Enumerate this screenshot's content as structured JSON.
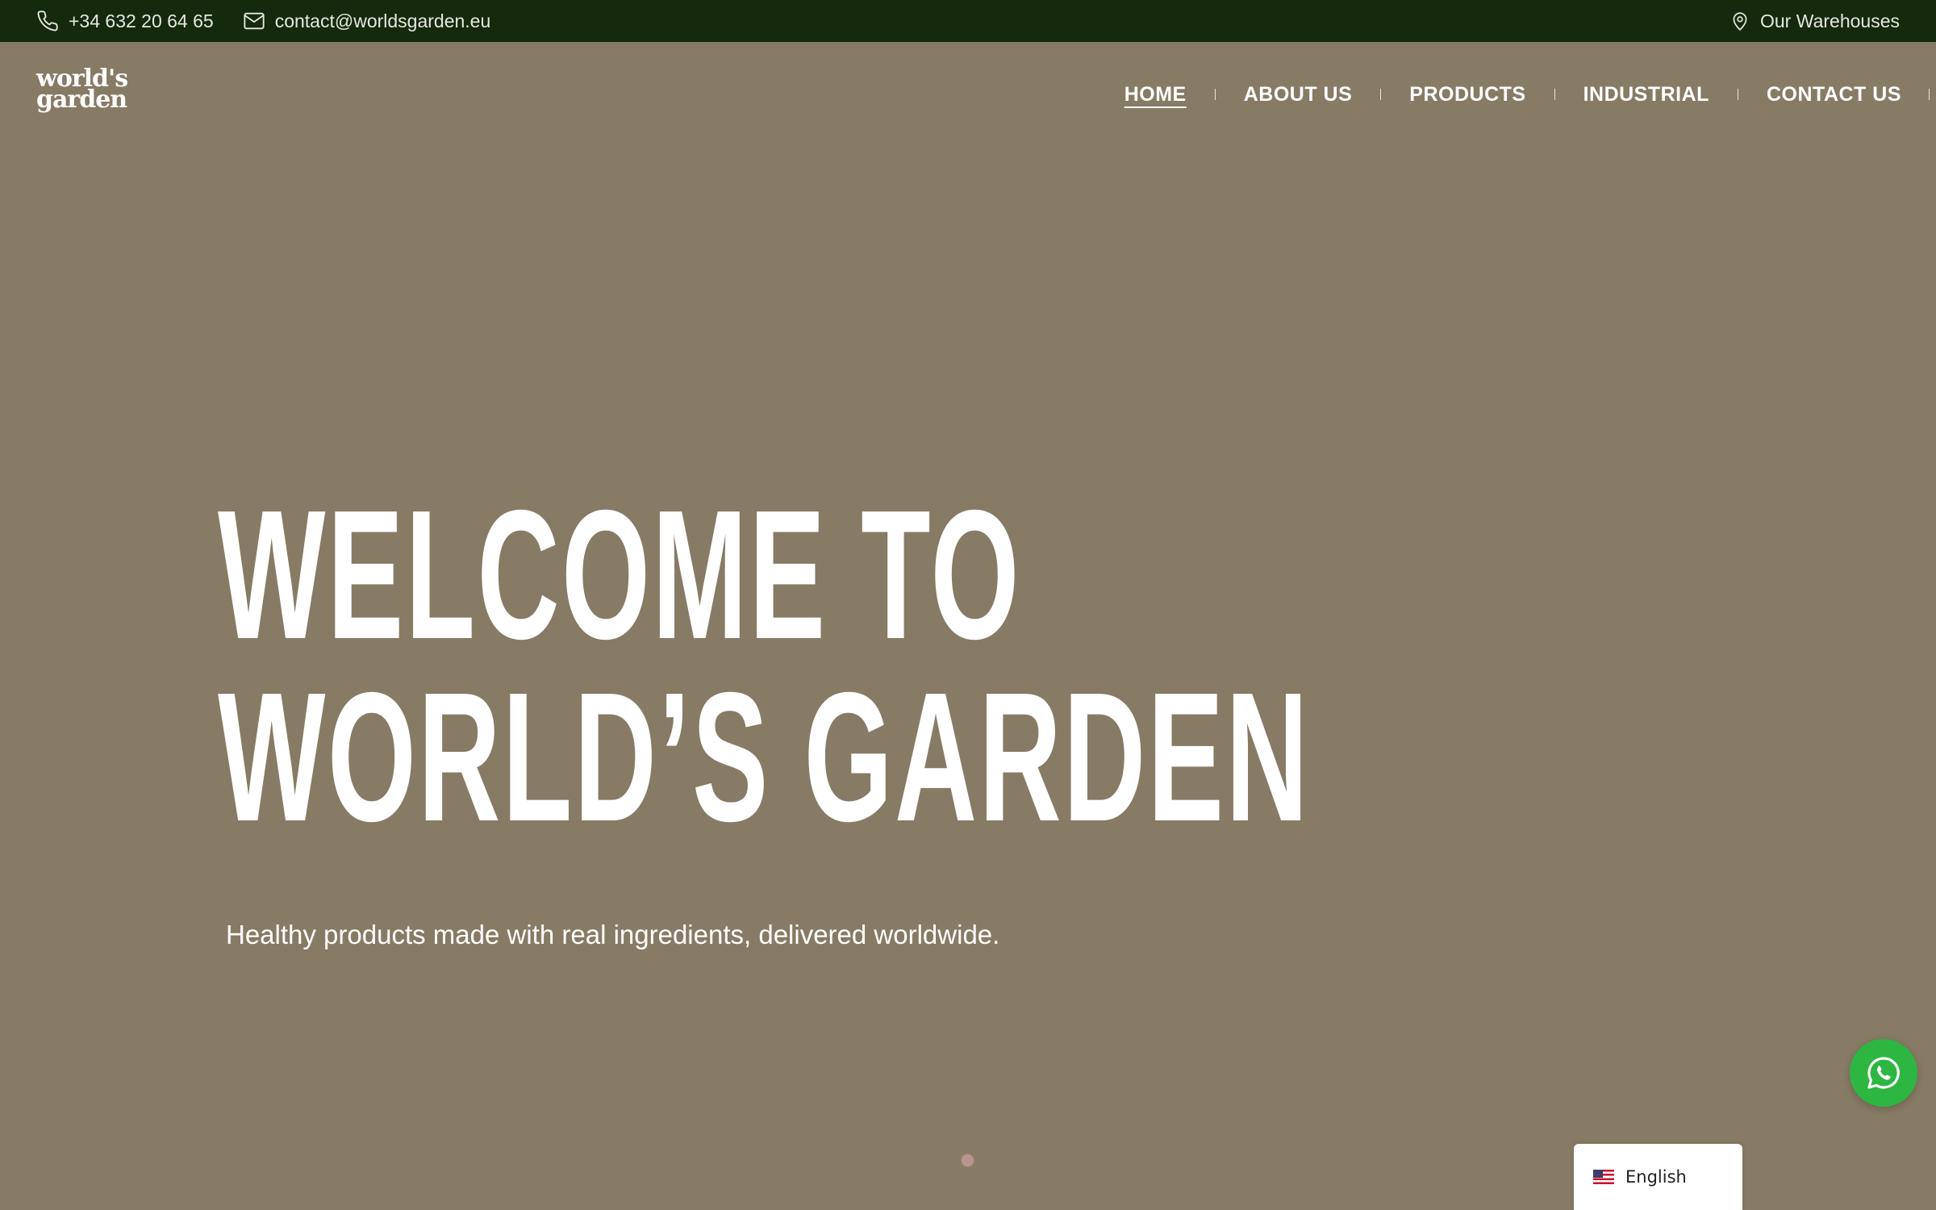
{
  "topbar": {
    "phone": "+34 632 20 64 65",
    "email": "contact@worldsgarden.eu",
    "warehouses": "Our Warehouses"
  },
  "logo": {
    "line1": "world's",
    "line2": "garden"
  },
  "nav": {
    "items": [
      {
        "label": "HOME",
        "active": true
      },
      {
        "label": "ABOUT US"
      },
      {
        "label": "PRODUCTS"
      },
      {
        "label": "INDUSTRIAL"
      },
      {
        "label": "CONTACT US"
      }
    ]
  },
  "hero": {
    "title_line1": "WELCOME TO",
    "title_line2": "WORLD’S GARDEN",
    "subtitle": "Healthy products made with real ingredients, delivered worldwide."
  },
  "language": {
    "selected": "English"
  },
  "icons": {
    "phone": "phone-icon",
    "email": "mail-icon",
    "location": "location-pin-icon",
    "whatsapp": "whatsapp-icon",
    "flag": "us-flag-icon"
  },
  "colors": {
    "topbar_bg": "#15290d",
    "hero_bg": "#877b65",
    "whatsapp_green": "#2db742",
    "slider_dot": "#b8968d"
  }
}
